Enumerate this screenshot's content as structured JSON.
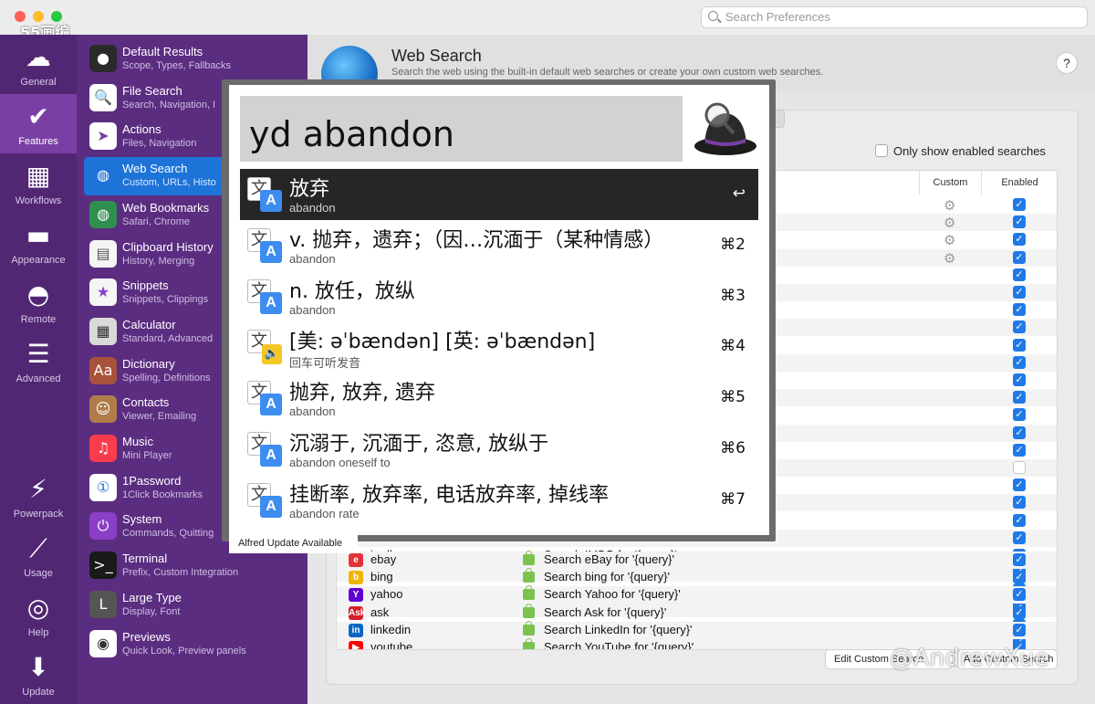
{
  "window": {
    "search_placeholder": "Search Preferences",
    "watermark_top": "55画编",
    "watermark_bottom": "@AndrewXue"
  },
  "rail": [
    {
      "label": "General",
      "icon": "hat-icon"
    },
    {
      "label": "Features",
      "icon": "checkmark-icon",
      "active": true
    },
    {
      "label": "Workflows",
      "icon": "grid-icon"
    },
    {
      "label": "Appearance",
      "icon": "paint-roller-icon"
    },
    {
      "label": "Remote",
      "icon": "remote-icon"
    },
    {
      "label": "Advanced",
      "icon": "sliders-icon"
    },
    {
      "label": "Powerpack",
      "icon": "battery-icon"
    },
    {
      "label": "Usage",
      "icon": "chart-icon"
    },
    {
      "label": "Help",
      "icon": "lifebuoy-icon"
    },
    {
      "label": "Update",
      "icon": "download-icon"
    }
  ],
  "features": [
    {
      "title": "Default Results",
      "sub": "Scope, Types, Fallbacks",
      "icon": "hat-icon"
    },
    {
      "title": "File Search",
      "sub": "Search, Navigation, I",
      "icon": "file-search-icon"
    },
    {
      "title": "Actions",
      "sub": "Files, Navigation",
      "icon": "actions-icon"
    },
    {
      "title": "Web Search",
      "sub": "Custom, URLs, Histo",
      "icon": "globe-icon",
      "selected": true
    },
    {
      "title": "Web Bookmarks",
      "sub": "Safari, Chrome",
      "icon": "bookmark-globe-icon"
    },
    {
      "title": "Clipboard History",
      "sub": "History, Merging",
      "icon": "clipboard-icon"
    },
    {
      "title": "Snippets",
      "sub": "Snippets, Clippings",
      "icon": "snippets-icon"
    },
    {
      "title": "Calculator",
      "sub": "Standard, Advanced",
      "icon": "calculator-icon"
    },
    {
      "title": "Dictionary",
      "sub": "Spelling, Definitions",
      "icon": "dictionary-icon"
    },
    {
      "title": "Contacts",
      "sub": "Viewer, Emailing",
      "icon": "contacts-icon"
    },
    {
      "title": "Music",
      "sub": "Mini Player",
      "icon": "music-icon"
    },
    {
      "title": "1Password",
      "sub": "1Click Bookmarks",
      "icon": "1password-icon"
    },
    {
      "title": "System",
      "sub": "Commands, Quitting",
      "icon": "power-icon"
    },
    {
      "title": "Terminal",
      "sub": "Prefix, Custom Integration",
      "icon": "terminal-icon"
    },
    {
      "title": "Large Type",
      "sub": "Display, Font",
      "icon": "large-type-icon"
    },
    {
      "title": "Previews",
      "sub": "Quick Look, Preview panels",
      "icon": "eye-icon"
    }
  ],
  "websearch": {
    "title": "Web Search",
    "desc": "Search the web using the built-in default web searches or create your own custom web searches.",
    "help": "?",
    "only_enabled": "Only show enabled searches",
    "col_custom": "Custom",
    "col_enabled": "Enabled",
    "rows": [
      {
        "kw": "ebay",
        "desc": "Search eBay for '{query}'",
        "fav": "e",
        "favcolor": "#e53238"
      },
      {
        "kw": "bing",
        "desc": "Search bing for '{query}'",
        "fav": "b",
        "favcolor": "#f2b400"
      },
      {
        "kw": "yahoo",
        "desc": "Search Yahoo for '{query}'",
        "fav": "Y",
        "favcolor": "#5f01d1"
      },
      {
        "kw": "ask",
        "desc": "Search Ask for '{query}'",
        "fav": "Ask",
        "favcolor": "#d5202a"
      },
      {
        "kw": "linkedin",
        "desc": "Search LinkedIn for '{query}'",
        "fav": "in",
        "favcolor": "#0a66c2"
      },
      {
        "kw": "youtube",
        "desc": "Search YouTube for '{query}'",
        "fav": "▶",
        "favcolor": "#ff0000"
      }
    ],
    "partial_row": {
      "kw": "imdb",
      "desc": "Search IMDB for '{query}'"
    },
    "edit_button": "Edit Custom Search",
    "add_button": "Add Custom Search"
  },
  "alfred": {
    "query": "yd abandon",
    "update_banner": "Alfred Update Available",
    "results": [
      {
        "title": "放弃",
        "sub": "abandon",
        "key": "↩",
        "icon": "translate-icon"
      },
      {
        "title": "v. 抛弃，遗弃；（因…沉湎于（某种情感）",
        "sub": "abandon",
        "key": "⌘2",
        "icon": "translate-icon"
      },
      {
        "title": "n. 放任，放纵",
        "sub": "abandon",
        "key": "⌘3",
        "icon": "translate-icon"
      },
      {
        "title": " [美: əˈbændən]  [英: əˈbændən]",
        "sub": "回车可听发音",
        "key": "⌘4",
        "icon": "translate-speaker-icon"
      },
      {
        "title": "抛弃, 放弃, 遗弃",
        "sub": "abandon",
        "key": "⌘5",
        "icon": "translate-icon"
      },
      {
        "title": "沉溺于, 沉湎于, 恣意, 放纵于",
        "sub": "abandon oneself to",
        "key": "⌘6",
        "icon": "translate-icon"
      },
      {
        "title": "挂断率, 放弃率, 电话放弃率, 掉线率",
        "sub": "abandon rate",
        "key": "⌘7",
        "icon": "translate-icon"
      }
    ]
  },
  "colors": {
    "rail": "#512773",
    "features_bg": "#5b2d80",
    "selected": "#1d73d8",
    "checkbox": "#1f7ae8"
  }
}
